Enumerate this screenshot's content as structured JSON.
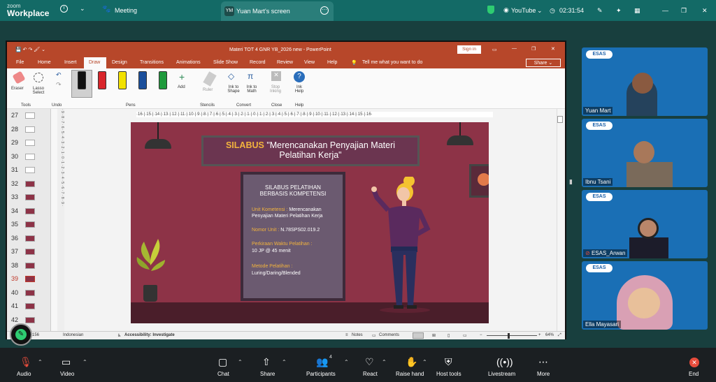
{
  "zoom": {
    "brand_small": "zoom",
    "brand_big": "Workplace",
    "meeting_label": "Meeting",
    "tab_initials": "YM",
    "tab_title": "Yuan Mart's screen",
    "youtube_label": "YouTube",
    "timer": "02:31:54"
  },
  "ppt": {
    "title": "Materi TOT 4  GNR YB_2026 new  -  PowerPoint",
    "signin": "Sign in",
    "share": "Share",
    "menu": [
      "File",
      "Home",
      "Insert",
      "Draw",
      "Design",
      "Transitions",
      "Animations",
      "Slide Show",
      "Record",
      "Review",
      "View",
      "Help"
    ],
    "tellme": "Tell me what you want to do",
    "ribbon": {
      "eraser": "Eraser",
      "lasso": "Lasso Select",
      "tools": "Tools",
      "undo": "Undo",
      "pens": "Pens",
      "add": "Add",
      "ruler": "Ruler",
      "stencils": "Stencils",
      "ink_shape": "Ink to Shape",
      "ink_math": "Ink to Math",
      "convert": "Convert",
      "stop_inking": "Stop Inking",
      "close": "Close",
      "ink_help": "Ink Help",
      "help": "Help"
    },
    "pen_colors": [
      "#111111",
      "#d9262b",
      "#f2e100",
      "#1b4f9b",
      "#1f9a3c"
    ],
    "thumbs": [
      "27",
      "28",
      "29",
      "30",
      "31",
      "32",
      "33",
      "34",
      "35",
      "36",
      "37",
      "38",
      "39",
      "40",
      "41",
      "42"
    ],
    "active_thumb": "39",
    "status": {
      "slide": "156",
      "lang": "Indonesian",
      "access": "Accessibility: Investigate",
      "notes": "Notes",
      "comments": "Comments",
      "zoom": "64%"
    },
    "ruler": "·16·|·15·|·14·|·13·|·12·|·11·|·10·|·9·|·8·|·7·|·6·|·5·|·4·|·3·|·2·|·1·|·0·|·1·|·2·|·3·|·4·|·5·|·6·|·7·|·8·|·9·|·10·|·11·|·12·|·13·|·14·|·15·|·16·"
  },
  "slide": {
    "title_accent": "SILABUS",
    "title_rest": " \"Merencanakan Penyajian Materi",
    "title_line2": "Pelatihan Kerja\"",
    "board_head1": "SILABUS PELATIHAN",
    "board_head2": "BERBASIS KOMPETENSI",
    "unit_label": "Unit Kometensi :",
    "unit_value": "Merencanakan",
    "unit_value2": "Penyajian Materi Pelatihan Kerja",
    "nomor_label": "Nomor Unit :",
    "nomor_value": "N.78SPS02.019.2",
    "waktu_label": "Perkiraan Waktu Pelatihan :",
    "waktu_value": "10 JP @ 45 menit",
    "metode_label": "Metode Pelatihan   :",
    "metode_value": "Luring/Daring/Blended"
  },
  "participants": [
    {
      "name": "Yuan Mart",
      "logo": "ESAS"
    },
    {
      "name": "Ibnu Tsani",
      "logo": "ESAS"
    },
    {
      "name": "ESAS_Arwan",
      "logo": "ESAS"
    },
    {
      "name": "Ella Mayasari",
      "logo": "ESAS"
    }
  ],
  "toolbar": {
    "audio": "Audio",
    "video": "Video",
    "chat": "Chat",
    "share": "Share",
    "participants": "Participants",
    "participants_count": "4",
    "react": "React",
    "raise": "Raise hand",
    "host": "Host tools",
    "live": "Livestream",
    "more": "More",
    "end": "End"
  }
}
